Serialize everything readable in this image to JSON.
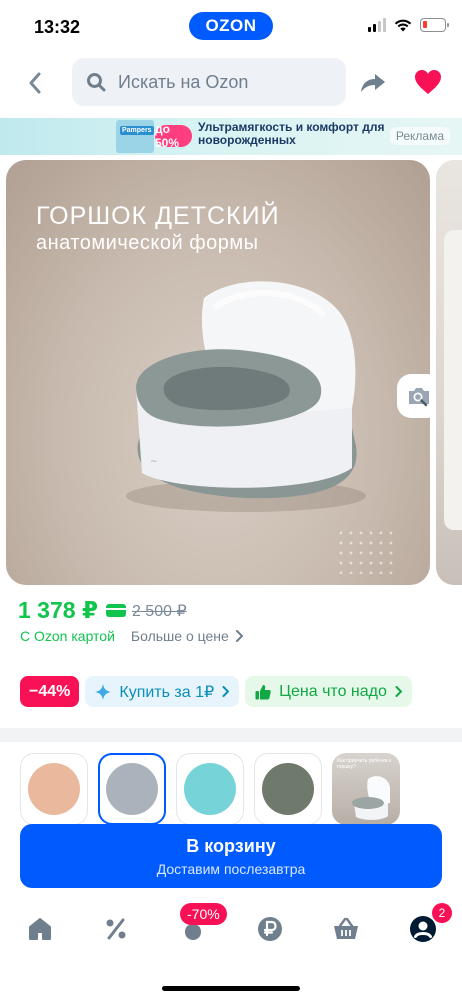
{
  "status_bar": {
    "time": "13:32",
    "app_badge": "OZON"
  },
  "search": {
    "placeholder": "Искать на Ozon"
  },
  "ad_banner": {
    "brand": "Pampers",
    "discount": "до 50%",
    "title": "Ультрамягкость и комфорт для новорожденных",
    "label": "Реклама"
  },
  "gallery": {
    "title": "ГОРШОК ДЕТСКИЙ",
    "subtitle": "анатомической формы"
  },
  "price": {
    "current": "1 378 ₽",
    "old": "2 500 ₽",
    "with_card": "С Ozon картой",
    "more": "Больше о цене"
  },
  "chips": {
    "discount": "−44%",
    "buy_for": "Купить за 1₽",
    "fair_price": "Цена что надо"
  },
  "variants": [
    {
      "color": "#eab89c"
    },
    {
      "color": "#aab2bb",
      "selected": true
    },
    {
      "color": "#76d3d8"
    },
    {
      "color": "#6f7a6c"
    },
    {
      "caption": "Как приучить ребенка к горшку?"
    }
  ],
  "cart": {
    "label": "В корзину",
    "delivery": "Доставим послезавтра"
  },
  "tabbar": {
    "promo_badge": "-70%",
    "cart_count": "2",
    "icons": [
      "home-icon",
      "percent-icon",
      "fresh-icon",
      "ruble-icon",
      "basket-icon",
      "profile-icon"
    ]
  },
  "colors": {
    "brand": "#005bff",
    "price": "#10c44c",
    "discount": "#f91155"
  }
}
